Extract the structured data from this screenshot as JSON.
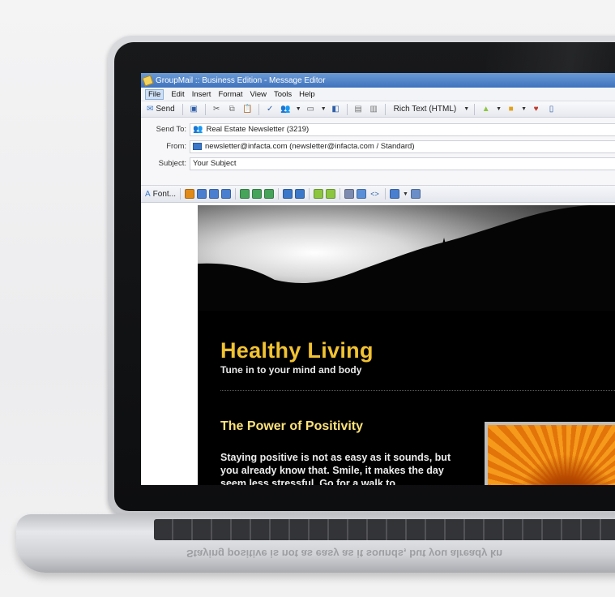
{
  "window": {
    "title": "GroupMail :: Business Edition - Message Editor"
  },
  "menu": [
    "File",
    "Edit",
    "Insert",
    "Format",
    "View",
    "Tools",
    "Help"
  ],
  "toolbar": {
    "send_label": "Send",
    "format_select": "Rich Text (HTML)"
  },
  "headers": {
    "send_to_label": "Send To:",
    "send_to_value": "Real Estate Newsletter (3219)",
    "from_label": "From:",
    "from_value": "newsletter@infacta.com (newsletter@infacta.com / Standard)",
    "subject_label": "Subject:",
    "subject_value": "Your Subject"
  },
  "format_bar": {
    "font_label": "Font..."
  },
  "email": {
    "title": "Healthy Living",
    "subtitle": "Tune in to your mind and body",
    "article_heading": "The Power of Positivity",
    "article_body": "Staying positive is not as easy as it sounds, but you already know that. Smile, it makes the day seem less stressful. Go for a walk to"
  },
  "colors": {
    "title_yellow": "#f1c232",
    "heading_yellow": "#fce27a",
    "titlebar_blue": "#3e72bd",
    "email_background": "#000000"
  },
  "icons": {
    "format_bar": [
      "text-color-icon",
      "bold-icon",
      "italic-icon",
      "underline-icon",
      "align-left-icon",
      "align-center-icon",
      "align-right-icon",
      "bullet-list-icon",
      "numbered-list-icon",
      "outdent-icon",
      "indent-icon",
      "horizontal-rule-icon",
      "image-icon",
      "html-source-icon",
      "table-icon",
      "grid-icon"
    ]
  }
}
